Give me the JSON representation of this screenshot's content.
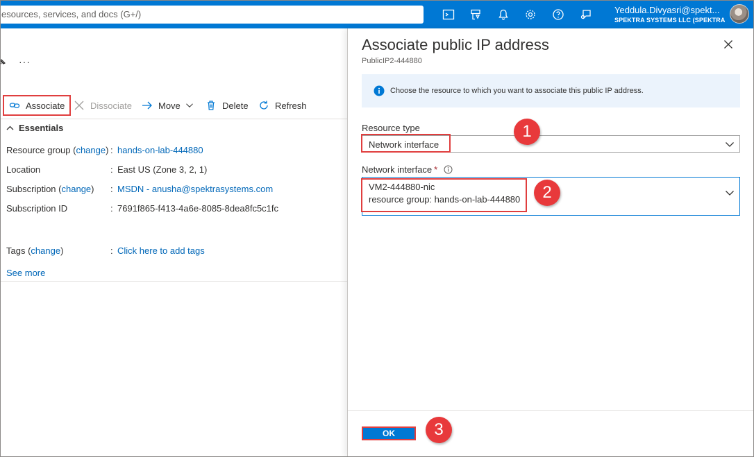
{
  "topbar": {
    "search_placeholder": "esources, services, and docs (G+/)",
    "icons": [
      "cloud-shell-icon",
      "directory-filter-icon",
      "notifications-icon",
      "settings-icon",
      "help-icon",
      "feedback-icon"
    ],
    "user_name": "Yeddula.Divyasri@spekt...",
    "user_org": "SPEKTRA SYSTEMS LLC (SPEKTRA..."
  },
  "left": {
    "ellipsis": "···",
    "commands": {
      "associate": "Associate",
      "dissociate": "Dissociate",
      "move": "Move",
      "delete": "Delete",
      "refresh": "Refresh"
    },
    "essentials_title": "Essentials",
    "resource_group": {
      "label": "Resource group",
      "change": "change",
      "value": "hands-on-lab-444880"
    },
    "location": {
      "label": "Location",
      "value": "East US (Zone 3, 2, 1)"
    },
    "subscription": {
      "label": "Subscription",
      "change": "change",
      "value": "MSDN - anusha@spektrasystems.com"
    },
    "subscription_id": {
      "label": "Subscription ID",
      "value": "7691f865-f413-4a6e-8085-8dea8fc5c1fc"
    },
    "tags": {
      "label": "Tags",
      "change": "change",
      "value": "Click here to add tags"
    },
    "see_more": "See more"
  },
  "panel": {
    "title": "Associate public IP address",
    "subtitle": "PublicIP2-444880",
    "info": "Choose the resource to which you want to associate this public IP address.",
    "resource_type_label": "Resource type",
    "resource_type_value": "Network interface",
    "nic_label": "Network interface",
    "nic_required": "*",
    "nic_value_line1": "VM2-444880-nic",
    "nic_value_line2": "resource group: hands-on-lab-444880",
    "ok_label": "OK"
  },
  "badges": [
    "1",
    "2",
    "3"
  ],
  "colors": {
    "accent": "#0078d4",
    "highlight": "#e03e3e",
    "link": "#0067b8"
  }
}
